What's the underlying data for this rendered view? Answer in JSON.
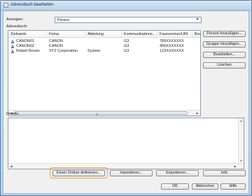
{
  "window": {
    "title": "Adressbuch bearbeiten"
  },
  "filter": {
    "label": "Anzeigen:",
    "value": "Person"
  },
  "addressbook": {
    "label": "Adressbuch:",
    "columns": [
      "Zielname",
      "Firma",
      "Abteilung",
      "Kommunikations...",
      "Faxnummer/URI",
      "Besc"
    ],
    "rows": [
      {
        "name": "CANON01",
        "company": "CANON",
        "department": "",
        "comm": "G3",
        "fax": "789XXXXXXX"
      },
      {
        "name": "CANON02",
        "company": "CANON",
        "department": "",
        "comm": "G3",
        "fax": "456XXXXXXX"
      },
      {
        "name": "Robert Brown",
        "company": "XYZ Corporation",
        "department": "System",
        "comm": "G3",
        "fax": "123XXXXXXX"
      }
    ]
  },
  "side_buttons": {
    "add_person": "Person hinzufügen...",
    "add_group": "Gruppe hinzufügen...",
    "edit": "Bearbeiten...",
    "delete": "Löschen"
  },
  "details": {
    "label": "Details:"
  },
  "bottom_buttons": {
    "define_folder": "Einen Ordner definieren...",
    "import": "Importieren...",
    "export": "Exportieren...",
    "info": "Info"
  },
  "dialog_buttons": {
    "ok": "OK",
    "cancel": "Abbrechen",
    "help": "Hilfe"
  },
  "icons": {
    "dropdown": "chevron-down-icon",
    "person": "person-icon"
  }
}
